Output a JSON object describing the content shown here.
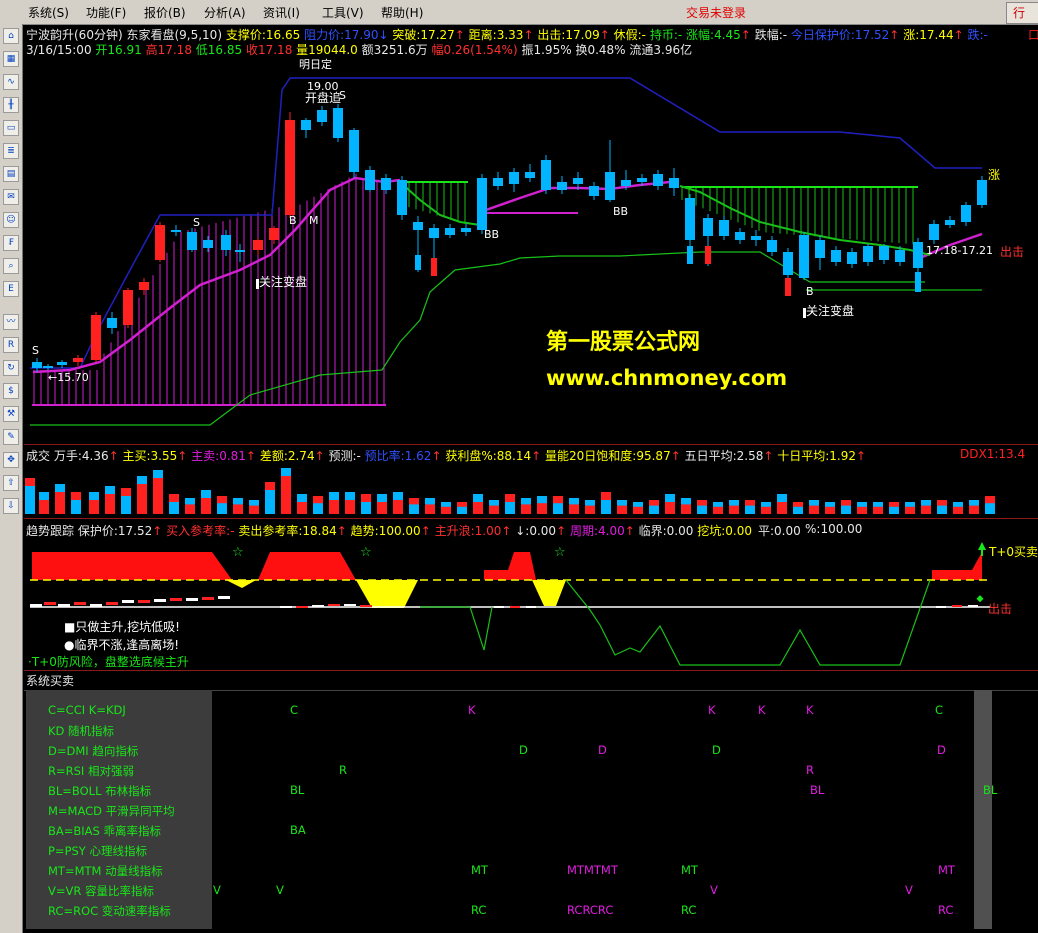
{
  "menu": {
    "items": [
      "系统(S)",
      "功能(F)",
      "报价(B)",
      "分析(A)",
      "资讯(I)",
      "工具(V)",
      "帮助(H)"
    ],
    "login_status": "交易未登录",
    "right_button": "行"
  },
  "main_chart": {
    "title": "宁波韵升(60分钟)",
    "indicator": "东家看盘(9,5,10)",
    "support": "支撑价:16.65",
    "resistance": "阻力价:17.90",
    "breakout": "突破:17.27",
    "distance": "距离:3.33",
    "exit": "出击:17.09",
    "holiday": "休假:-",
    "hold": "持币:-",
    "rise": "涨幅:4.45",
    "fall": "跌幅:-",
    "protect": "今日保护价:17.52",
    "up_price": "涨:17.44",
    "down_price": "跌:-",
    "info_date": "3/16/15:00",
    "info_open": "开16.91",
    "info_high": "高17.18",
    "info_low": "低16.85",
    "info_close": "收17.18",
    "info_vol": "量19044.0",
    "info_amount": "额3251.6万",
    "info_pct": "幅0.26(1.54%)",
    "info_swing": "振1.95%",
    "info_turn": "换0.48%",
    "info_float": "流通3.96亿",
    "label_top": "明日定",
    "label_19": "19.00",
    "label_open_chase": "开盘追",
    "label_S_top": "S",
    "label_S1": "S",
    "label_S2": "S",
    "label_S3": "S",
    "label_B1": "B",
    "label_M": "M",
    "label_BB1": "BB",
    "label_BB2": "BB",
    "label_B2": "B",
    "label_15_70": "←15.70",
    "label_watch1": "关注变盘",
    "label_watch2": "关注变盘",
    "label_range": "17.18-17.21",
    "label_exit": "出击",
    "label_up": "涨",
    "watermark_cn": "第一股票公式网",
    "watermark_url": "www.chnmoney.com"
  },
  "volume_panel": {
    "label": "成交",
    "hand": "万手:4.36",
    "main_buy": "主买:3.55",
    "main_sell": "主卖:0.81",
    "diff": "差额:2.74",
    "predict": "预测:-",
    "ratio": "预比率:1.62",
    "profit": "获利盘%:88.14",
    "saturation": "量能20日饱和度:95.87",
    "avg5": "五日平均:2.58",
    "avg10": "十日平均:1.92",
    "ddx": "DDX1:13.4"
  },
  "trend_panel": {
    "label": "趋势跟踪",
    "protect": "保护价:17.52",
    "buy_ref": "买入参考率:-",
    "sell_ref": "卖出参考率:18.84",
    "trend": "趋势:100.00",
    "main_up": "主升浪:1.00",
    "flag": "↓:0.00",
    "period": "周期:4.00",
    "critical": "临界:0.00",
    "dig": "挖坑:0.00",
    "flat": "平:0.00",
    "pct": "%:100.00",
    "note1": "■只做主升,挖坑低吸!",
    "note2": "●临界不涨,逢高离场!",
    "note3": "·T+0防风险，盘整选底候主升",
    "t0_buy": "T+0买卖",
    "exit": "出击"
  },
  "system_panel": {
    "label": "系统买卖",
    "legend": [
      "C=CCI     K=KDJ",
      "KD 随机指标",
      "D=DMI 趋向指标",
      "R=RSI 相对强弱",
      "BL=BOLL  布林指标",
      "M=MACD 平滑异同平均",
      "BA=BIAS 乖离率指标",
      "P=PSY  心理线指标",
      "MT=MTM 动量线指标",
      "V=VR 容量比率指标",
      "RC=ROC 变动速率指标"
    ],
    "signals": [
      {
        "t": "C",
        "c": "#19e619"
      },
      {
        "t": "K",
        "c": "#e01ee0"
      },
      {
        "t": "K",
        "c": "#e01ee0"
      },
      {
        "t": "K",
        "c": "#e01ee0"
      },
      {
        "t": "K",
        "c": "#e01ee0"
      },
      {
        "t": "C",
        "c": "#19e619"
      },
      {
        "t": "D",
        "c": "#19e619"
      },
      {
        "t": "D",
        "c": "#e01ee0"
      },
      {
        "t": "D",
        "c": "#19e619"
      },
      {
        "t": "D",
        "c": "#e01ee0"
      },
      {
        "t": "R",
        "c": "#19e619"
      },
      {
        "t": "R",
        "c": "#e01ee0"
      },
      {
        "t": "BL",
        "c": "#19e619"
      },
      {
        "t": "BL",
        "c": "#e01ee0"
      },
      {
        "t": "BL",
        "c": "#19e619"
      },
      {
        "t": "BA",
        "c": "#19e619"
      },
      {
        "t": "MT",
        "c": "#19e619"
      },
      {
        "t": "MTMTMT",
        "c": "#e01ee0"
      },
      {
        "t": "MT",
        "c": "#19e619"
      },
      {
        "t": "MT",
        "c": "#e01ee0"
      },
      {
        "t": "V",
        "c": "#19e619"
      },
      {
        "t": "V",
        "c": "#19e619"
      },
      {
        "t": "V",
        "c": "#e01ee0"
      },
      {
        "t": "V",
        "c": "#e01ee0"
      },
      {
        "t": "RC",
        "c": "#19e619"
      },
      {
        "t": "RCRCRC",
        "c": "#e01ee0"
      },
      {
        "t": "RC",
        "c": "#19e619"
      },
      {
        "t": "RC",
        "c": "#e01ee0"
      }
    ]
  },
  "toolbar": {
    "icons": [
      "home-icon",
      "table-icon",
      "line-chart-icon",
      "candle-chart-icon",
      "window-icon",
      "list-icon",
      "grid-icon",
      "gift-icon",
      "users-icon",
      "fund-icon",
      "search-icon",
      "etf-icon",
      "wave-icon",
      "rsi-icon",
      "refresh-icon",
      "dollar-icon",
      "tools-icon",
      "pencil-icon",
      "move-icon",
      "up-arrow-icon",
      "down-arrow-icon"
    ],
    "glyphs": [
      "⌂",
      "▦",
      "∿",
      "╫",
      "▭",
      "≣",
      "▤",
      "✉",
      "☺",
      "₣",
      "⌕",
      "E",
      "〰",
      "R",
      "↻",
      "$",
      "⚒",
      "✎",
      "✥",
      "⇧",
      "⇩"
    ]
  },
  "colors": {
    "candle_up": "#ff2020",
    "candle_down": "#00b4ff",
    "ma_magenta": "#d020d0",
    "resist_blue": "#2020c0",
    "support_green": "#19c019",
    "text_yellow": "#ffff00"
  }
}
